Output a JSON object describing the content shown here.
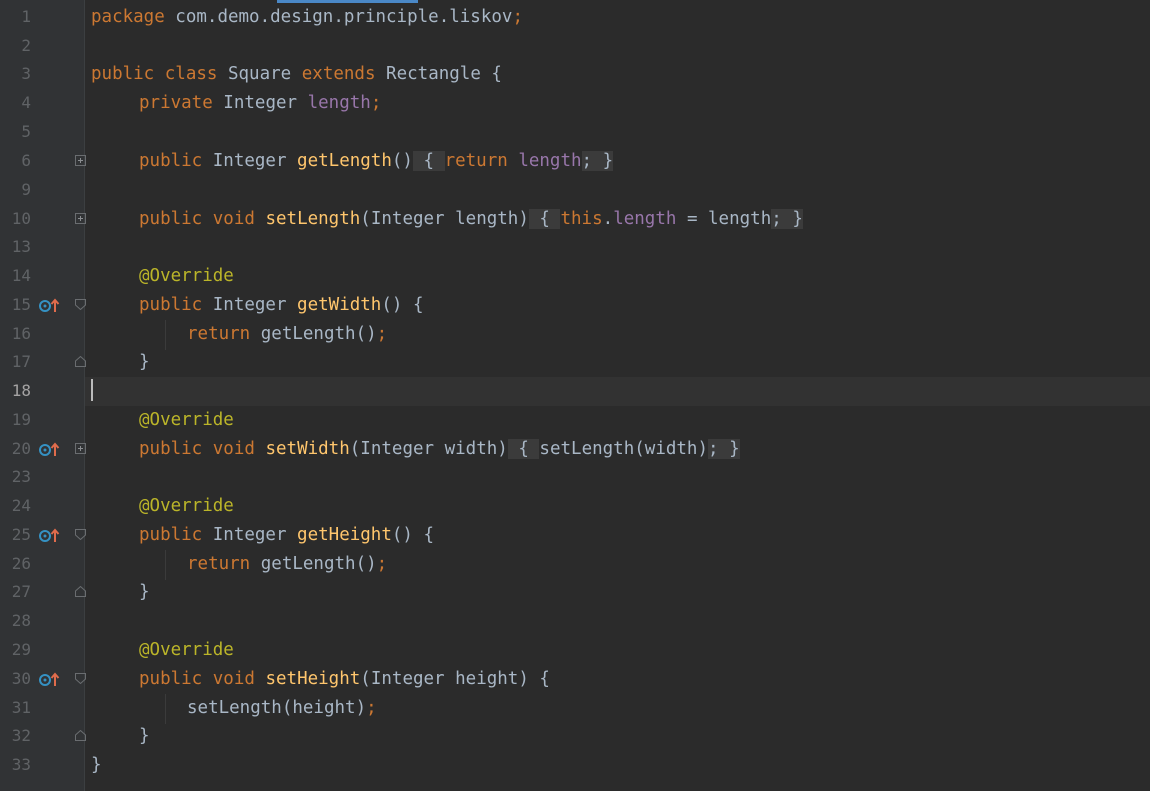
{
  "editor": {
    "lines": [
      {
        "n": "1"
      },
      {
        "n": "2"
      },
      {
        "n": "3"
      },
      {
        "n": "4"
      },
      {
        "n": "5"
      },
      {
        "n": "6"
      },
      {
        "n": "9"
      },
      {
        "n": "10"
      },
      {
        "n": "13"
      },
      {
        "n": "14"
      },
      {
        "n": "15"
      },
      {
        "n": "16"
      },
      {
        "n": "17"
      },
      {
        "n": "18"
      },
      {
        "n": "19"
      },
      {
        "n": "20"
      },
      {
        "n": "23"
      },
      {
        "n": "24"
      },
      {
        "n": "25"
      },
      {
        "n": "26"
      },
      {
        "n": "27"
      },
      {
        "n": "28"
      },
      {
        "n": "29"
      },
      {
        "n": "30"
      },
      {
        "n": "31"
      },
      {
        "n": "32"
      },
      {
        "n": "33"
      }
    ],
    "code": {
      "l1_kw": "package",
      "l1_pkg": " com.demo.design.principle.liskov",
      "l1_semi": ";",
      "l3_pub": "public",
      "l3_class": "class",
      "l3_name": " Square ",
      "l3_ext": "extends",
      "l3_parent": " Rectangle {",
      "l4_priv": "private",
      "l4_type": " Integer ",
      "l4_field": "length",
      "l4_semi": ";",
      "l6_pub": "public",
      "l6_type": " Integer ",
      "l6_fn": "getLength",
      "l6_paren": "()",
      "l6_open": " { ",
      "l6_ret": "return",
      "l6_sp": " ",
      "l6_field": "length",
      "l6_semi": ";",
      "l6_close": " }",
      "l10_pub": "public",
      "l10_void": "void",
      "l10_fn": "setLength",
      "l10_args": "(Integer length)",
      "l10_open": " { ",
      "l10_this": "this",
      "l10_dot": ".",
      "l10_field": "length",
      "l10_rest": " = length",
      "l10_semi": ";",
      "l10_close": " }",
      "ann": "@Override",
      "l15_pub": "public",
      "l15_type": " Integer ",
      "l15_fn": "getWidth",
      "l15_rest": "() {",
      "l16_ret": "return",
      "l16_call": " getLength()",
      "l16_semi": ";",
      "brace_close": "}",
      "l20_pub": "public",
      "l20_void": "void",
      "l20_fn": "setWidth",
      "l20_args": "(Integer width)",
      "l20_open": " { ",
      "l20_call": "setLength(width)",
      "l20_semi": ";",
      "l20_close": " }",
      "l25_pub": "public",
      "l25_type": " Integer ",
      "l25_fn": "getHeight",
      "l25_rest": "() {",
      "l26_ret": "return",
      "l26_call": " getLength()",
      "l26_semi": ";",
      "l30_pub": "public",
      "l30_void": "void",
      "l30_fn": "setHeight",
      "l30_rest": "(Integer height) {",
      "l31_call": "setLength(height)",
      "l31_semi": ";",
      "l33_close": "}"
    },
    "icons": {
      "override": "override-implements-icon",
      "fold_expand": "fold-expand-icon",
      "fold_collapse": "fold-collapse-icon"
    },
    "colors": {
      "background": "#2b2b2b",
      "keyword": "#cc7832",
      "function": "#ffc66d",
      "field": "#9876aa",
      "annotation": "#bbb529",
      "text": "#a9b7c6"
    }
  }
}
